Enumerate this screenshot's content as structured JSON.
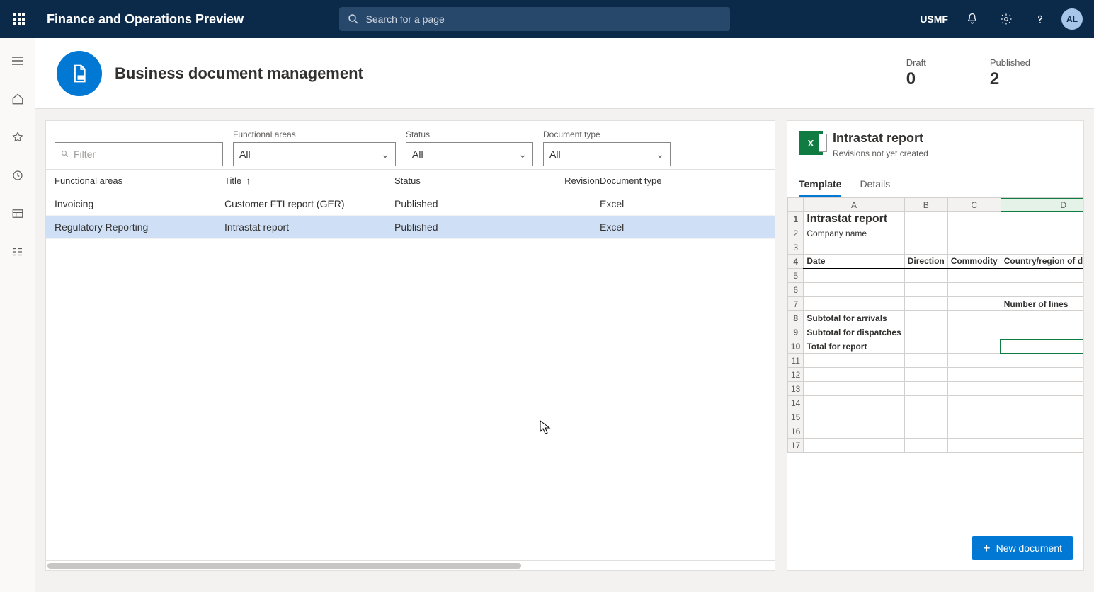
{
  "topbar": {
    "brand": "Finance and Operations Preview",
    "search_placeholder": "Search for a page",
    "entity": "USMF",
    "avatar_initials": "AL"
  },
  "page": {
    "title": "Business document management",
    "kpis": [
      {
        "label": "Draft",
        "value": "0"
      },
      {
        "label": "Published",
        "value": "2"
      }
    ]
  },
  "filters": {
    "filter_placeholder": "Filter",
    "functional_label": "Functional areas",
    "functional_value": "All",
    "status_label": "Status",
    "status_value": "All",
    "doctype_label": "Document type",
    "doctype_value": "All"
  },
  "columns": {
    "functional": "Functional areas",
    "title": "Title",
    "status": "Status",
    "revision": "Revision",
    "doctype": "Document type"
  },
  "rows": [
    {
      "functional": "Invoicing",
      "title": "Customer FTI report (GER)",
      "status": "Published",
      "revision": "",
      "doctype": "Excel",
      "selected": false
    },
    {
      "functional": "Regulatory Reporting",
      "title": "Intrastat report",
      "status": "Published",
      "revision": "",
      "doctype": "Excel",
      "selected": true
    }
  ],
  "preview": {
    "title": "Intrastat report",
    "subtitle": "Revisions not yet created",
    "tabs": {
      "template": "Template",
      "details": "Details"
    },
    "new_button": "New document",
    "sheet": {
      "columns": [
        "A",
        "B",
        "C",
        "D"
      ],
      "rows": [
        {
          "n": "1",
          "A": "Intrastat report",
          "bold": true
        },
        {
          "n": "2",
          "A": "Company name"
        },
        {
          "n": "3"
        },
        {
          "n": "4",
          "A": "Date",
          "B": "Direction",
          "C": "Commodity",
          "D": "Country/region of destination",
          "header": true
        },
        {
          "n": "5"
        },
        {
          "n": "6"
        },
        {
          "n": "7",
          "D": "Number of lines",
          "boldD": true
        },
        {
          "n": "8",
          "A": "Subtotal for arrivals",
          "bold": true
        },
        {
          "n": "9",
          "A": "Subtotal for dispatches",
          "bold": true
        },
        {
          "n": "10",
          "A": "Total for report",
          "bold": true,
          "selD": true
        },
        {
          "n": "11"
        },
        {
          "n": "12"
        },
        {
          "n": "13"
        },
        {
          "n": "14"
        },
        {
          "n": "15"
        },
        {
          "n": "16"
        },
        {
          "n": "17"
        }
      ]
    }
  }
}
